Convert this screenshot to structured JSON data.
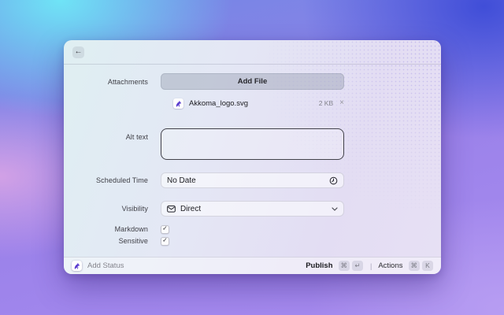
{
  "icons": {
    "back": "←",
    "remove": "×",
    "check": "✓",
    "command": "⌘",
    "separator": "|"
  },
  "window": {
    "form": {
      "attachments_label": "Attachments",
      "add_file_button": "Add File",
      "file": {
        "name": "Akkoma_logo.svg",
        "size": "2 KB"
      },
      "alt_text_label": "Alt text",
      "alt_text_value": "",
      "scheduled_time_label": "Scheduled Time",
      "scheduled_time_value": "No Date",
      "visibility_label": "Visibility",
      "visibility_value": "Direct",
      "markdown_label": "Markdown",
      "markdown_checked": true,
      "sensitive_label": "Sensitive",
      "sensitive_checked": true
    },
    "footer": {
      "add_status": "Add Status",
      "publish": "Publish",
      "publish_keys": [
        "⌘",
        "↵"
      ],
      "actions": "Actions",
      "actions_keys": [
        "⌘",
        "K"
      ]
    }
  },
  "colors": {
    "bg_cyan": "#6fe4f6",
    "bg_blue": "#404ed8",
    "bg_pink": "#dea6e6",
    "bg_purple_light": "#b79df2",
    "accent_purple": "#5b3dcf"
  }
}
